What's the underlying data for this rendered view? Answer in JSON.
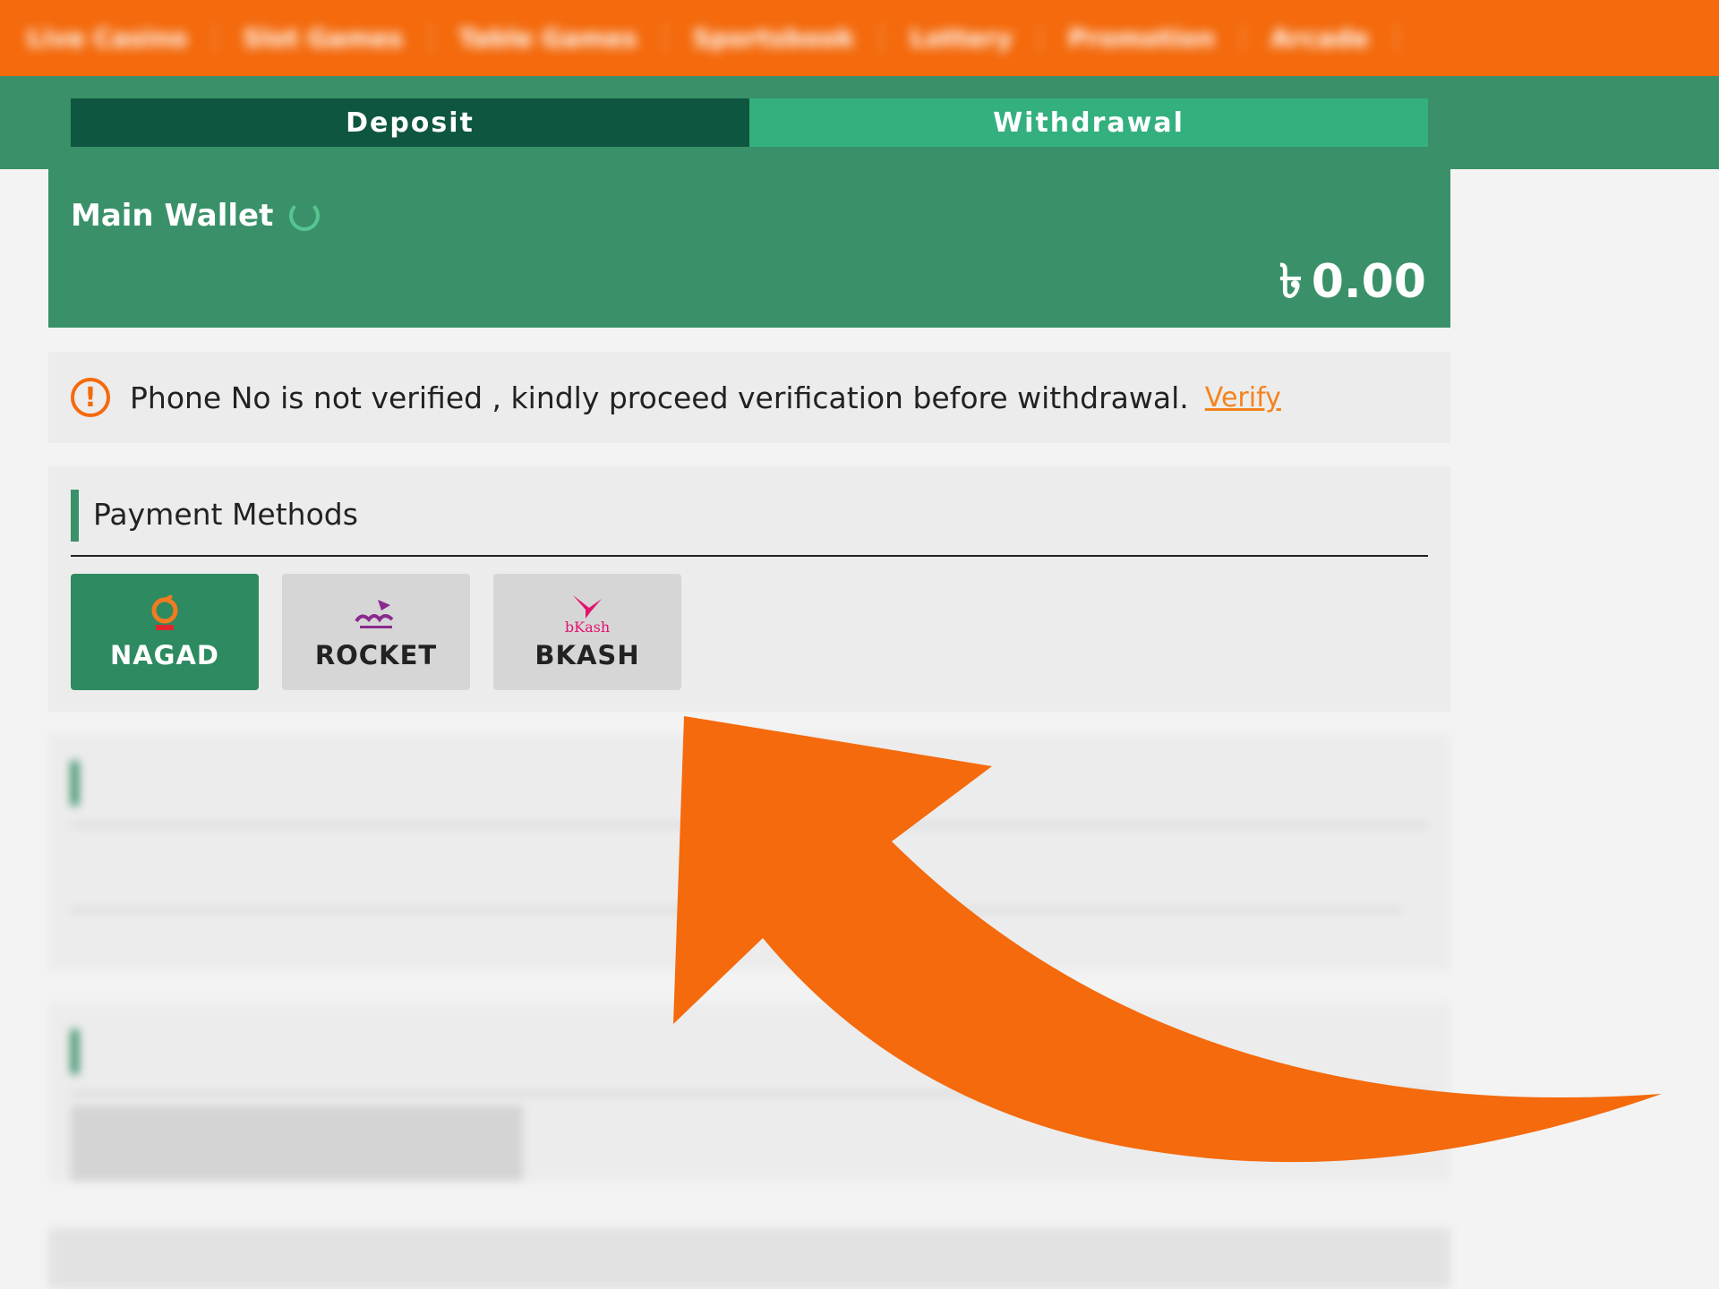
{
  "nav": {
    "items": [
      "Live Casino",
      "Slot Games",
      "Table Games",
      "Sportsbook",
      "Lottery",
      "Promotion",
      "Arcade"
    ]
  },
  "tabs": {
    "deposit": "Deposit",
    "withdrawal": "Withdrawal"
  },
  "wallet": {
    "title": "Main Wallet",
    "currency": "৳",
    "balance": "0.00"
  },
  "notice": {
    "message": "Phone No is not verified , kindly proceed verification before withdrawal.",
    "action": "Verify"
  },
  "payment_methods": {
    "heading": "Payment Methods",
    "methods": [
      {
        "label": "NAGAD",
        "selected": true
      },
      {
        "label": "ROCKET",
        "selected": false
      },
      {
        "label": "BKASH",
        "selected": false
      }
    ],
    "bkash_logo_text": "bKash"
  },
  "colors": {
    "accent_orange": "#f46a0d",
    "primary_green": "#3a9169",
    "dark_green": "#0e5640",
    "tab_green": "#33b07e"
  }
}
